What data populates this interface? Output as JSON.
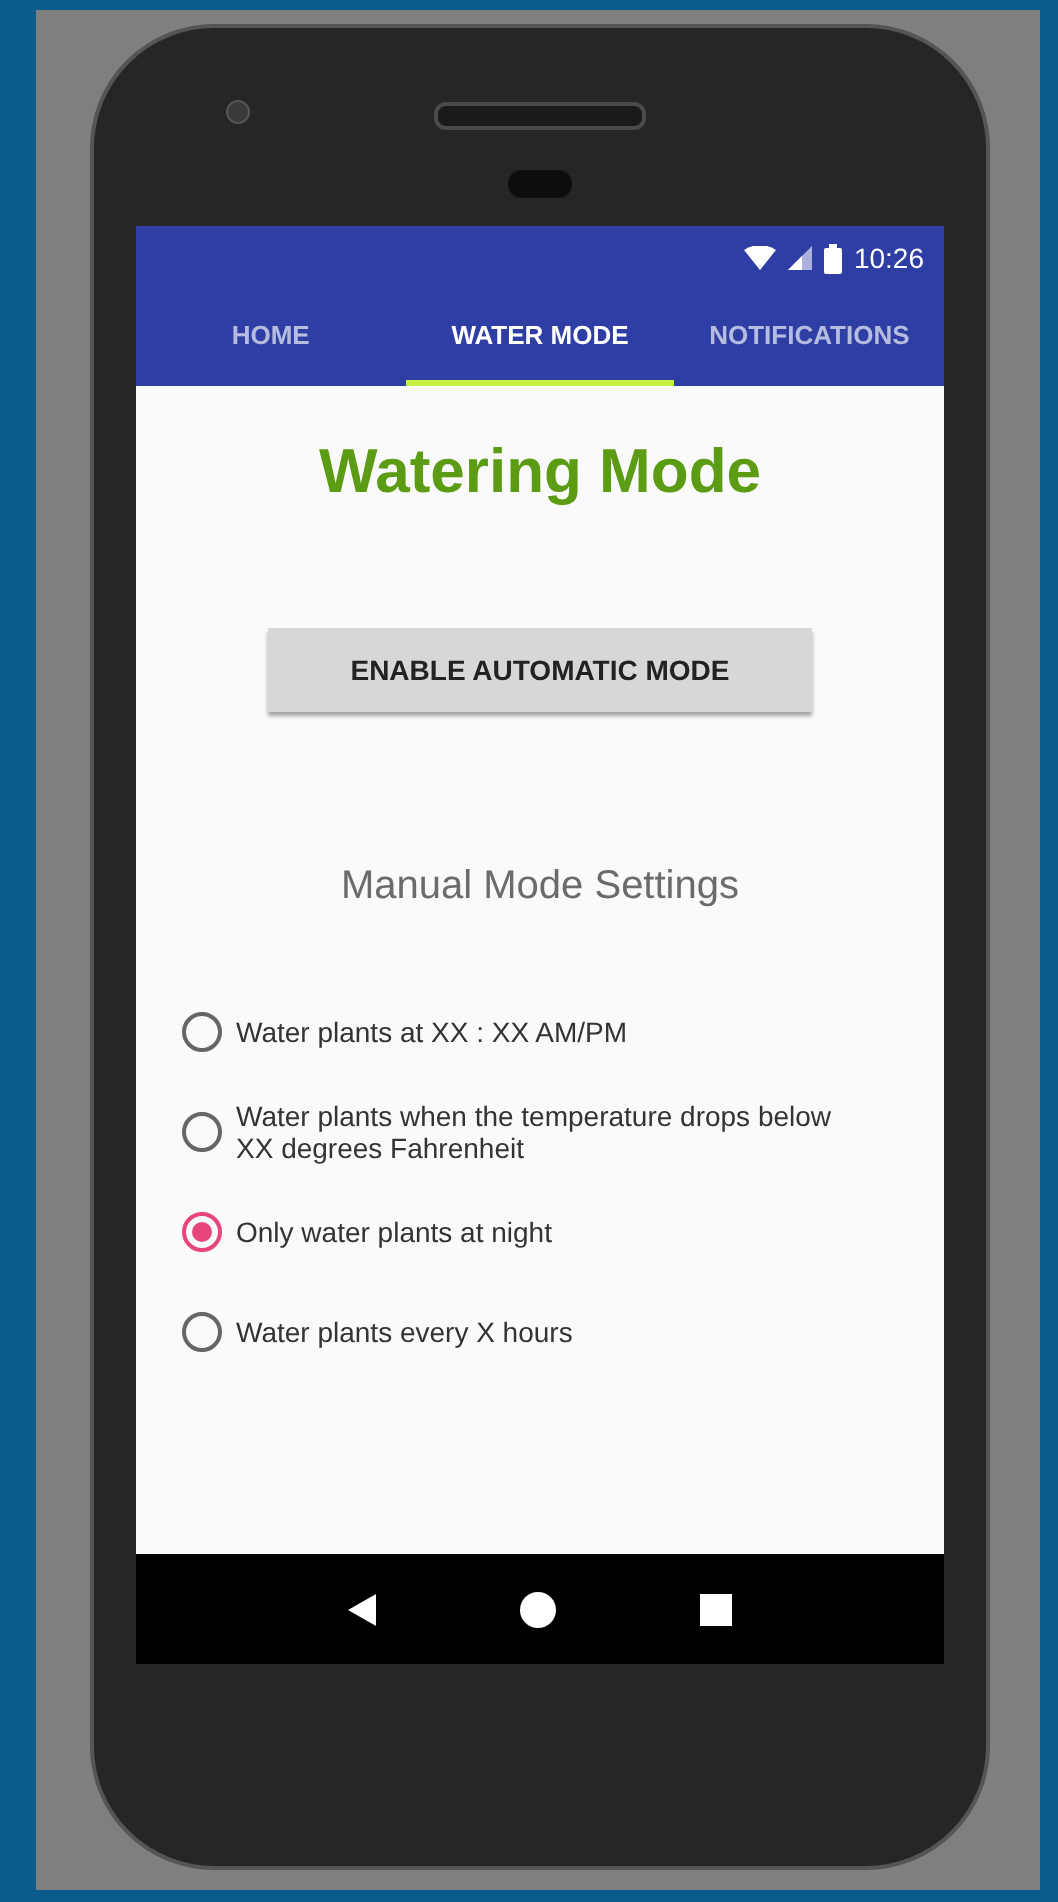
{
  "status_bar": {
    "time": "10:26"
  },
  "tabs": [
    {
      "label": "HOME",
      "selected": false
    },
    {
      "label": "WATER MODE",
      "selected": true
    },
    {
      "label": "NOTIFICATIONS",
      "selected": false
    }
  ],
  "title": "Watering Mode",
  "automatic_button": "ENABLE AUTOMATIC MODE",
  "section_title": "Manual Mode Settings",
  "options": [
    {
      "label": "Water plants at XX : XX AM/PM",
      "selected": false
    },
    {
      "label": "Water plants when the temperature drops below XX degrees Fahrenheit",
      "selected": false
    },
    {
      "label": "Only water plants at night",
      "selected": true
    },
    {
      "label": "Water plants every X hours",
      "selected": false
    }
  ]
}
